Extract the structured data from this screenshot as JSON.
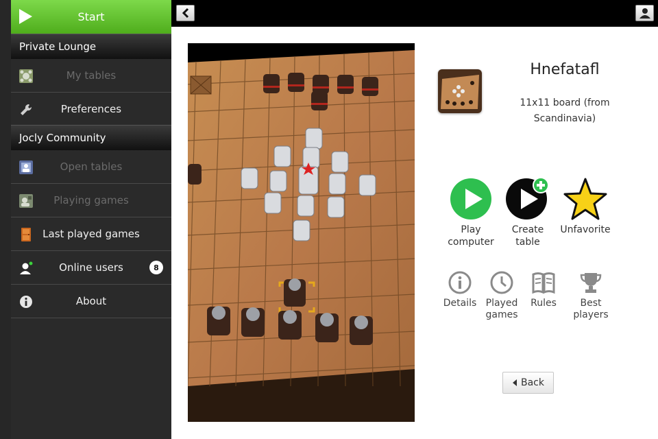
{
  "sidebar": {
    "start": {
      "label": "Start",
      "icon": "play-icon"
    },
    "sections": [
      {
        "title": "Private Lounge"
      },
      {
        "title": "Jocly Community"
      }
    ],
    "items": [
      {
        "label": "My tables",
        "icon": "my-tables-icon",
        "enabled": false
      },
      {
        "label": "Preferences",
        "icon": "wrench-icon",
        "enabled": true
      },
      {
        "label": "Open tables",
        "icon": "open-tables-icon",
        "enabled": false
      },
      {
        "label": "Playing games",
        "icon": "playing-games-icon",
        "enabled": false
      },
      {
        "label": "Last played games",
        "icon": "door-icon",
        "enabled": true
      },
      {
        "label": "Online users",
        "icon": "user-icon",
        "enabled": true,
        "badge": "8"
      },
      {
        "label": "About",
        "icon": "info-icon",
        "enabled": true
      }
    ]
  },
  "topbar": {
    "back_icon": "chevron-left-icon",
    "user_icon": "user-icon"
  },
  "game": {
    "title": "Hnefatafl",
    "description": "11x11 board (from Scandinavia)"
  },
  "actions": {
    "play_computer": "Play computer",
    "create_table": "Create table",
    "unfavorite": "Unfavorite"
  },
  "links": {
    "details": "Details",
    "played_games": "Played games",
    "rules": "Rules",
    "best_players": "Best players"
  },
  "back_button": {
    "label": "Back"
  },
  "colors": {
    "accent_green": "#55b521",
    "play_green": "#2ebf4f",
    "star_yellow": "#f7d117",
    "dark_bg": "#2a2a2a"
  }
}
